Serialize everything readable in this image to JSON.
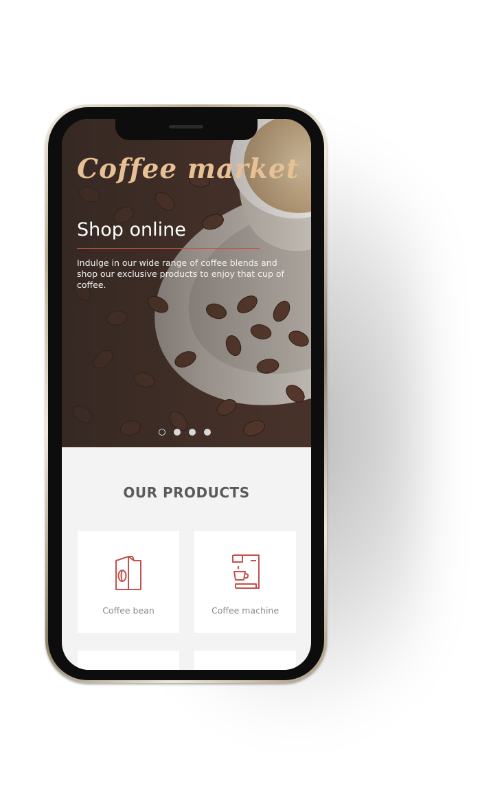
{
  "hero": {
    "brand": "Coffee market",
    "headline": "Shop online",
    "description": "Indulge in our wide range of coffee blends and shop our exclusive products to enjoy that cup of coffee.",
    "carousel_slides": 4,
    "carousel_active_index": 0,
    "accent_color": "#c4514b",
    "brand_color": "#e7c095"
  },
  "products": {
    "title": "OUR PRODUCTS",
    "items": [
      {
        "label": "Coffee bean",
        "icon": "coffee-bag-icon"
      },
      {
        "label": "Coffee machine",
        "icon": "coffee-machine-icon"
      }
    ],
    "icon_color": "#c4514b"
  }
}
